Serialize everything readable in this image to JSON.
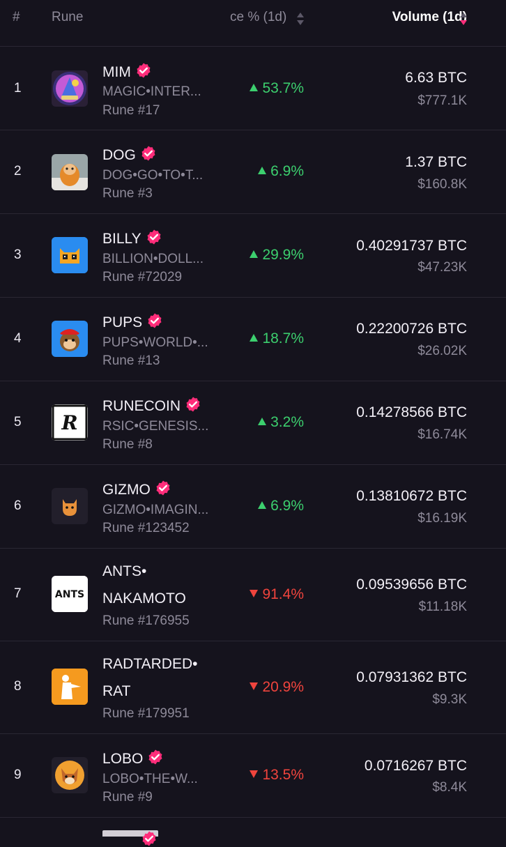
{
  "header": {
    "rank": "#",
    "rune": "Rune",
    "change": "ce % (1d)",
    "volume": "Volume (1d)"
  },
  "rows": [
    {
      "rank": "1",
      "name": "MIM",
      "verified": true,
      "symbol": "MAGIC•INTER...",
      "rune_no": "Rune #17",
      "change": "53.7%",
      "direction": "up",
      "btc": "6.63 BTC",
      "usd": "$777.1K",
      "logo": "wizard-logo-icon"
    },
    {
      "rank": "2",
      "name": "DOG",
      "verified": true,
      "symbol": "DOG•GO•TO•T...",
      "rune_no": "Rune #3",
      "change": "6.9%",
      "direction": "up",
      "btc": "1.37 BTC",
      "usd": "$160.8K",
      "logo": "dog-photo-icon"
    },
    {
      "rank": "3",
      "name": "BILLY",
      "verified": true,
      "symbol": "BILLION•DOLL...",
      "rune_no": "Rune #72029",
      "change": "29.9%",
      "direction": "up",
      "btc": "0.40291737 BTC",
      "usd": "$47.23K",
      "logo": "cat-face-icon"
    },
    {
      "rank": "4",
      "name": "PUPS",
      "verified": true,
      "symbol": "PUPS•WORLD•...",
      "rune_no": "Rune #13",
      "change": "18.7%",
      "direction": "up",
      "btc": "0.22200726 BTC",
      "usd": "$26.02K",
      "logo": "monkey-face-icon"
    },
    {
      "rank": "5",
      "name": "RUNECOIN",
      "verified": true,
      "symbol": "RSIC•GENESIS...",
      "rune_no": "Rune #8",
      "change": "3.2%",
      "direction": "up",
      "btc": "0.14278566 BTC",
      "usd": "$16.74K",
      "logo": "runecoin-r-icon"
    },
    {
      "rank": "6",
      "name": "GIZMO",
      "verified": true,
      "symbol": "GIZMO•IMAGIN...",
      "rune_no": "Rune #123452",
      "change": "6.9%",
      "direction": "up",
      "btc": "0.13810672 BTC",
      "usd": "$16.19K",
      "logo": "gizmo-cat-icon"
    },
    {
      "rank": "7",
      "name_line1": "ANTS•",
      "name_line2": "NAKAMOTO",
      "verified": false,
      "rune_no": "Rune #176955",
      "change": "91.4%",
      "direction": "down",
      "btc": "0.09539656 BTC",
      "usd": "$11.18K",
      "logo": "ants-text-icon",
      "logo_text": "ANTS"
    },
    {
      "rank": "8",
      "name_line1": "RADTARDED•",
      "name_line2": "RAT",
      "verified": false,
      "rune_no": "Rune #179951",
      "change": "20.9%",
      "direction": "down",
      "btc": "0.07931362 BTC",
      "usd": "$9.3K",
      "logo": "rat-figure-icon"
    },
    {
      "rank": "9",
      "name": "LOBO",
      "verified": true,
      "symbol": "LOBO•THE•W...",
      "rune_no": "Rune #9",
      "change": "13.5%",
      "direction": "down",
      "btc": "0.0716267 BTC",
      "usd": "$8.4K",
      "logo": "wolf-face-icon"
    }
  ],
  "colors": {
    "background": "#15131d",
    "up": "#3ccf6e",
    "down": "#f0443d",
    "verified": "#ff2d7a",
    "muted": "#8e8a99"
  }
}
